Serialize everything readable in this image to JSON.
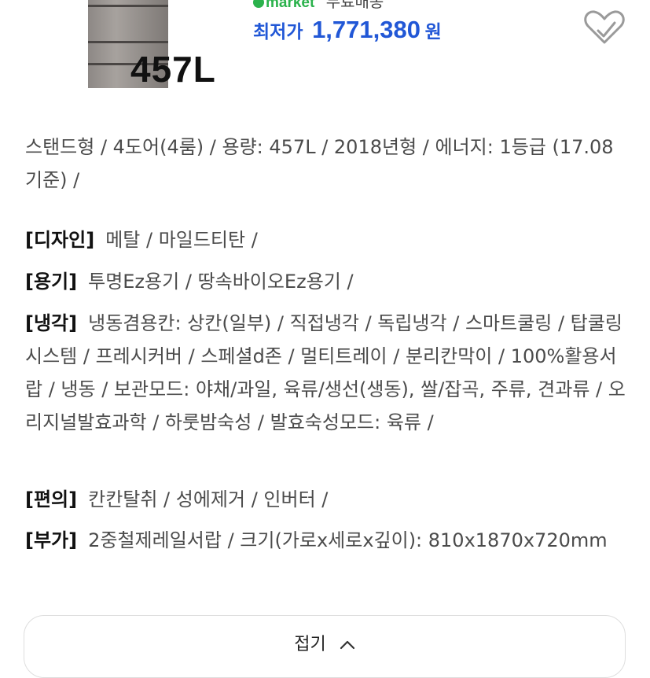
{
  "product": {
    "capacity_label": "457L",
    "seller_name": "market",
    "shipping": "무료배송",
    "price_label": "최저가",
    "price_value": "1,771,380",
    "price_unit": "원"
  },
  "summary": "스탠드형 / 4도어(4룸) / 용량: 457L / 2018년형 / 에너지: 1등급 (17.08 기준) /",
  "specs": [
    {
      "key": "[디자인]",
      "value": "메탈 / 마일드티탄 /"
    },
    {
      "key": "[용기]",
      "value": "투명Ez용기 / 땅속바이오Ez용기 /"
    },
    {
      "key": "[냉각]",
      "value": "냉동겸용칸: 상칸(일부) / 직접냉각 / 독립냉각 / 스마트쿨링 / 탑쿨링시스템 / 프레시커버 / 스페셜d존 / 멀티트레이 / 분리칸막이 / 100%활용서랍 / 냉동 / 보관모드: 야채/과일, 육류/생선(생동), 쌀/잡곡, 주류, 견과류 / 오리지널발효과학 / 하룻밤숙성 / 발효숙성모드: 육류 /"
    },
    {
      "key": "[편의]",
      "value": "칸칸탈취 / 성에제거 / 인버터 /"
    },
    {
      "key": "[부가]",
      "value": "2중철제레일서랍 / 크기(가로x세로x깊이): 810x1870x720mm"
    }
  ],
  "collapse_label": "접기",
  "icons": {
    "wishlist": "heart-outline-icon",
    "collapse": "chevron-up-icon"
  }
}
